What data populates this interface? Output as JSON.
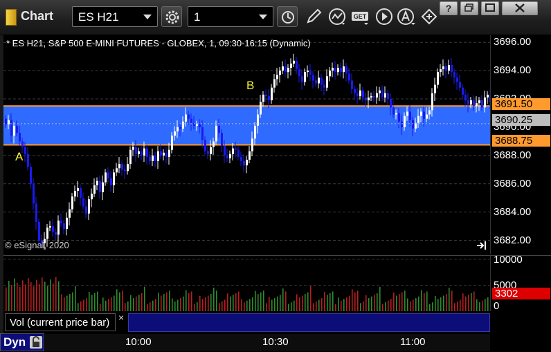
{
  "window": {
    "title": "Chart",
    "symbol": "ES H21",
    "interval": "1",
    "get_label": "GET"
  },
  "chart_info": {
    "label": "* ES H21, S&P 500 E-MINI FUTURES - GLOBEX, 1, 09:30-16:15 (Dynamic)",
    "copyright": "© eSignal, 2020",
    "annotation_a": "A",
    "annotation_b": "B"
  },
  "price_labels": {
    "upper": "3691.50",
    "current": "3690.25",
    "lower": "3688.75"
  },
  "volume_panel": {
    "label": "Vol (current price bar)",
    "close_symbol": "×",
    "current_value": "3302"
  },
  "bottom": {
    "dyn_label": "Dyn"
  },
  "colors": {
    "up_candle": "#ffffff",
    "down_candle": "#1a1af0",
    "band_fill": "#2f6bff",
    "band_edge": "#ff9a2e",
    "current_bg": "#bdbdbd",
    "volume_up": "#2e8b2e",
    "volume_down": "#b81e1e",
    "volume_current": "#dd0000",
    "annotation": "#f2f23c"
  },
  "chart_data": {
    "type": "candlestick",
    "symbol": "ES H21",
    "y_ticks": [
      "3696.00",
      "3694.00",
      "3692.00",
      "3690.00",
      "3688.00",
      "3686.00",
      "3684.00",
      "3682.00"
    ],
    "ylim": [
      3681.0,
      3696.5
    ],
    "volume_ticks": [
      "10000",
      "5000",
      "0"
    ],
    "volume_ylim": [
      0,
      10000
    ],
    "x_ticks": [
      "10:00",
      "10:30",
      "11:00"
    ],
    "highlight_band": [
      3688.75,
      3691.5
    ],
    "current_price": 3690.25,
    "current_volume": 3302,
    "annotations": [
      {
        "label": "A",
        "price": 3688.0
      },
      {
        "label": "B",
        "price": 3692.5
      }
    ],
    "grid": true
  }
}
